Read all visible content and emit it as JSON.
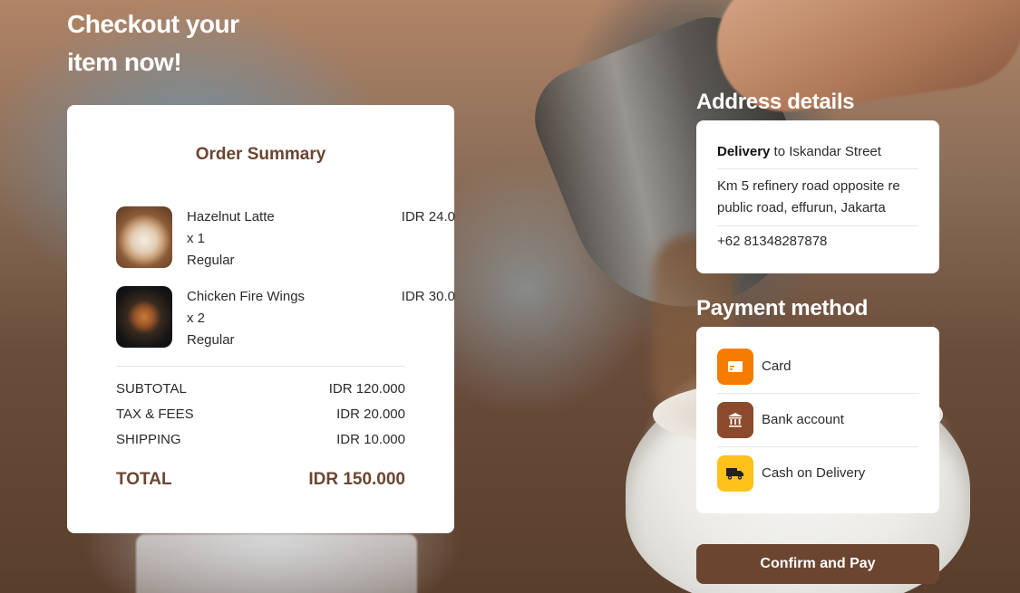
{
  "headline": {
    "line1": "Checkout your",
    "line2": "item now!"
  },
  "order_summary": {
    "title": "Order Summary",
    "items": [
      {
        "name": "Hazelnut Latte",
        "qty": "x 1",
        "variant": "Regular",
        "price": "IDR 24.0",
        "thumb": "hazelnut-latte-photo"
      },
      {
        "name": "Chicken Fire Wings",
        "qty": "x 2",
        "variant": "Regular",
        "price": "IDR 30.0",
        "thumb": "chicken-fire-wings-photo"
      }
    ],
    "subtotal_label": "SUBTOTAL",
    "subtotal_value": "IDR 120.000",
    "tax_label": "TAX & FEES",
    "tax_value": "IDR 20.000",
    "shipping_label": "SHIPPING",
    "shipping_value": "IDR 10.000",
    "total_label": "TOTAL",
    "total_value": "IDR 150.000"
  },
  "address": {
    "title": "Address details",
    "delivery_bold": "Delivery",
    "delivery_rest": " to Iskandar Street",
    "street_line1": "Km 5 refinery road opposite re",
    "street_line2": "public road, effurun, Jakarta",
    "phone": "+62 81348287878"
  },
  "payment": {
    "title": "Payment method",
    "methods": [
      {
        "label": "Card",
        "icon": "card-icon",
        "color": "#F57C00"
      },
      {
        "label": "Bank account",
        "icon": "bank-icon",
        "color": "#8B4A2B"
      },
      {
        "label": "Cash on Delivery",
        "icon": "delivery-truck-icon",
        "color": "#FFC21A"
      }
    ]
  },
  "confirm_label": "Confirm and Pay",
  "colors": {
    "brand_brown": "#6B4530",
    "card_bg": "#FFFFFF",
    "text": "#2B2B2B"
  }
}
